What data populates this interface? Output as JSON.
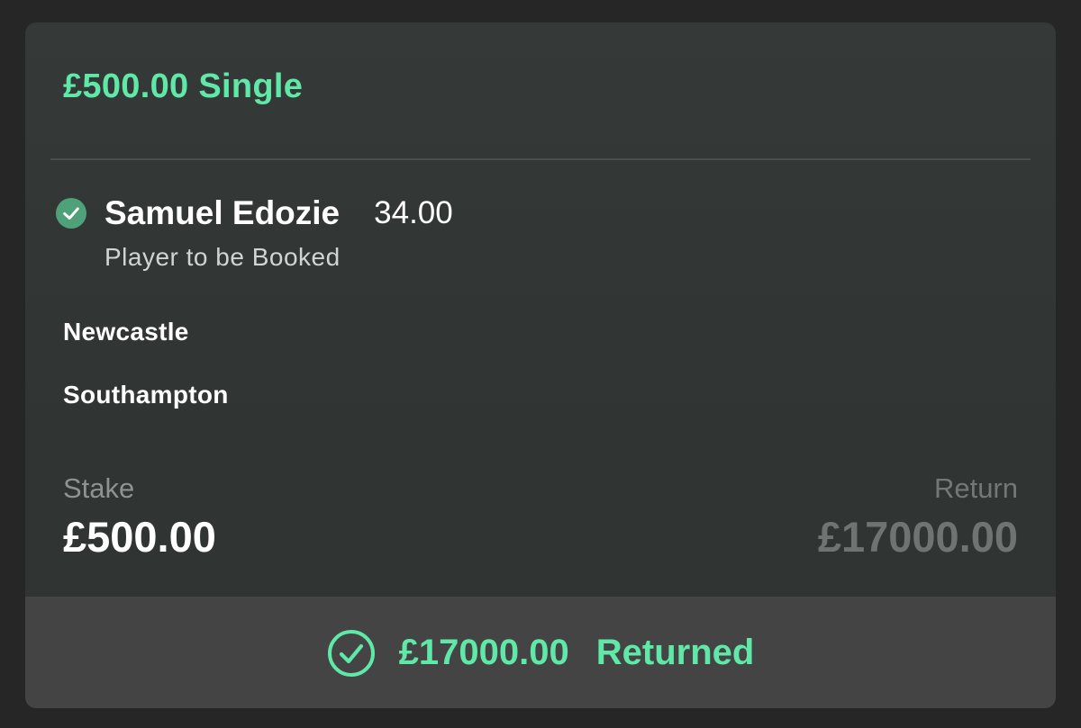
{
  "bet": {
    "title": "£500.00 Single"
  },
  "selection": {
    "name": "Samuel Edozie",
    "odds": "34.00",
    "market": "Player to be Booked",
    "status_icon": "check-circle-filled-icon"
  },
  "event": {
    "home_team": "Newcastle",
    "away_team": "Southampton"
  },
  "summary": {
    "stake_label": "Stake",
    "stake_value": "£500.00",
    "return_label": "Return",
    "return_value": "£17000.00"
  },
  "footer": {
    "icon": "check-circle-outline-icon",
    "amount": "£17000.00",
    "status": "Returned"
  },
  "colors": {
    "accent": "#5fe8a7",
    "card_background": "#333735",
    "footer_background": "#444444",
    "check_badge": "#4fa17a"
  }
}
